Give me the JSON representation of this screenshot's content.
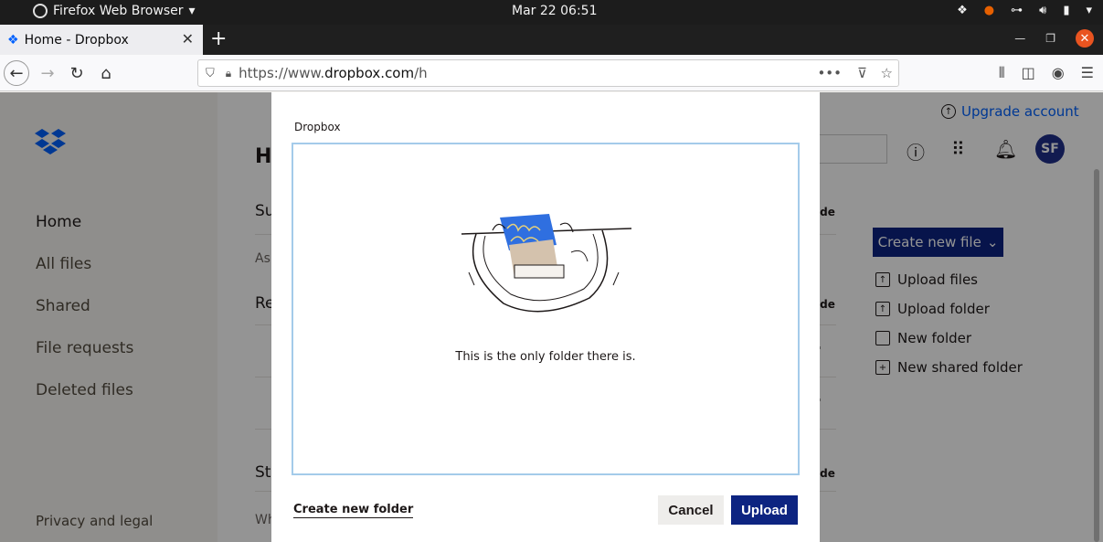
{
  "system_bar": {
    "app_name": "Firefox Web Browser",
    "clock": "Mar 22  06:51"
  },
  "browser": {
    "tab_title": "Home - Dropbox",
    "url_prefix": "https://www.",
    "url_domain": "dropbox.com",
    "url_suffix": "/h"
  },
  "sidebar": {
    "items": [
      {
        "label": "Home"
      },
      {
        "label": "All files"
      },
      {
        "label": "Shared"
      },
      {
        "label": "File requests"
      },
      {
        "label": "Deleted files"
      }
    ],
    "footer_link": "Privacy and legal"
  },
  "main": {
    "title_fragment": "Ho",
    "section1_fragment": "Su",
    "section1_sub": "As",
    "section2_fragment": "Re",
    "section3_fragment": "St",
    "section3_sub": "Wh",
    "hide_label": "ide",
    "row_menu": "·"
  },
  "header": {
    "upgrade_label": "Upgrade account",
    "avatar_initials": "SF"
  },
  "actions": {
    "create_new_file": "Create new file",
    "items": [
      {
        "label": "Upload files",
        "icon": "upload-file-icon"
      },
      {
        "label": "Upload folder",
        "icon": "upload-folder-icon"
      },
      {
        "label": "New folder",
        "icon": "folder-icon"
      },
      {
        "label": "New shared folder",
        "icon": "shared-folder-icon"
      }
    ]
  },
  "modal": {
    "title": "Dropbox",
    "empty_message": "This is the only folder there is.",
    "create_folder_label": "Create new folder",
    "cancel_label": "Cancel",
    "upload_label": "Upload"
  },
  "colors": {
    "dropbox_blue": "#0061fe",
    "primary_navy": "#0d2481",
    "picker_border": "#a4cbea",
    "ubuntu_orange": "#e95420"
  }
}
